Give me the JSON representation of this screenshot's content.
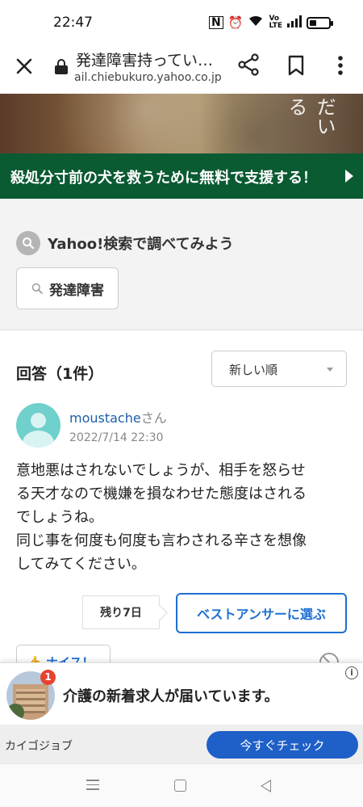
{
  "status_bar": {
    "time": "22:47",
    "icons": [
      "nfc-icon",
      "alarm-icon",
      "wifi-icon",
      "volte-icon",
      "signal-icon",
      "battery-icon"
    ],
    "battery_level": 0.35
  },
  "browser": {
    "page_title": "発達障害持ってい…",
    "domain": "ail.chiebukuro.yahoo.co.jp"
  },
  "hero": {
    "overlay_text": "だいる"
  },
  "banner": {
    "text_part1": "殺処分寸前の犬を救うために",
    "text_emphasis": "無料",
    "text_part2": "で支援する！"
  },
  "search": {
    "heading": "Yahoo!検索で調べてみよう",
    "chip_label": "発達障害"
  },
  "answers": {
    "heading": "回答（1件）",
    "sort_label": "新しい順",
    "items": [
      {
        "username": "moustache",
        "honorific": "さん",
        "timestamp": "2022/7/14 22:30",
        "body_lines": [
          "意地悪はされないでしょうが、相手を怒らせ",
          "る天才なので機嫌を損なわせた態度はされる",
          "でしょうね。",
          "同じ事を何度も何度も言わされる辛さを想像",
          "してみてください。"
        ],
        "remaining": "残り7日",
        "best_answer_label": "ベストアンサーに選ぶ",
        "nice_label": "ナイス！"
      }
    ]
  },
  "ad": {
    "badge_count": "1",
    "headline": "介護の新着求人が届いています。",
    "advertiser": "カイゴジョブ",
    "cta": "今すぐチェック",
    "info_icon": "i"
  },
  "colors": {
    "banner_bg": "#0a5a32",
    "link_blue": "#1a5fa8",
    "cta_blue": "#1e5fc8",
    "avatar_teal": "#6fd0cc",
    "badge_red": "#e8432f"
  }
}
